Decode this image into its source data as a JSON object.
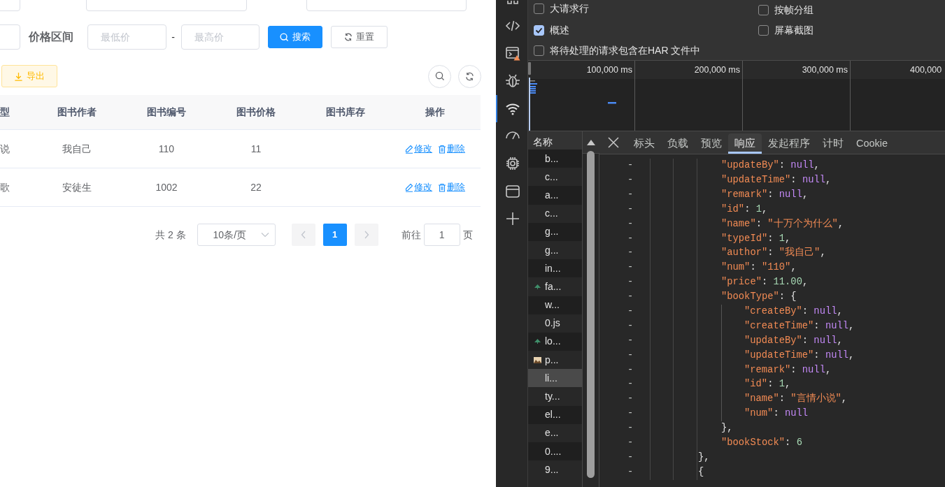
{
  "search_form": {
    "price_range": {
      "label": "价格区间",
      "min_placeholder": "最低价",
      "separator": "-",
      "max_placeholder": "最高价"
    },
    "search_button": "搜索",
    "reset_button": "重置"
  },
  "toolbar": {
    "export_button": "导出"
  },
  "table": {
    "columns": [
      "型",
      "图书作者",
      "图书编号",
      "图书价格",
      "图书库存",
      "操作"
    ],
    "rows": [
      {
        "type": "说",
        "author": "我自己",
        "num": "110",
        "price": "11",
        "actions": [
          "修改",
          "删除"
        ]
      },
      {
        "type": "歌",
        "author": "安徒生",
        "num": "1002",
        "price": "22",
        "actions": [
          "修改",
          "删除"
        ]
      }
    ]
  },
  "pagination": {
    "total": "共 2 条",
    "page_size": "10条/页",
    "prev_disabled": true,
    "next_disabled": true,
    "pages": [
      {
        "label": "1",
        "selected": true
      }
    ],
    "goto_label": "前往",
    "goto_value": "1",
    "page_suffix": "页"
  },
  "activity_bar": {
    "items": [
      {
        "kind": "panels",
        "selected": false
      },
      {
        "kind": "code",
        "selected": false
      },
      {
        "kind": "console",
        "selected": false,
        "warning": true
      },
      {
        "kind": "bug",
        "selected": false
      },
      {
        "kind": "wifi",
        "selected": true
      },
      {
        "kind": "gauge",
        "selected": false
      },
      {
        "kind": "chip",
        "selected": false
      },
      {
        "kind": "window",
        "selected": false
      },
      {
        "kind": "plus",
        "selected": false
      }
    ]
  },
  "settings": {
    "options": [
      {
        "label": "大请求行",
        "checked": false
      },
      {
        "label": "按帧分组",
        "checked": false
      },
      {
        "label": "概述",
        "checked": true
      },
      {
        "label": "屏幕截图",
        "checked": false
      },
      {
        "label": "将待处理的请求包含在HAR 文件中",
        "checked": false
      }
    ]
  },
  "timeline": {
    "ticks": [
      "100,000 ms",
      "200,000 ms",
      "300,000 ms",
      "400,000"
    ]
  },
  "request_list": {
    "header": "名称",
    "items": [
      {
        "name": "b...",
        "kind": "plain",
        "selected": false
      },
      {
        "name": "c...",
        "kind": "plain",
        "selected": false
      },
      {
        "name": "a...",
        "kind": "plain",
        "selected": false
      },
      {
        "name": "c...",
        "kind": "plain",
        "selected": false
      },
      {
        "name": "g...",
        "kind": "plain",
        "selected": false
      },
      {
        "name": "g...",
        "kind": "plain",
        "selected": false
      },
      {
        "name": "in...",
        "kind": "plain",
        "selected": false
      },
      {
        "name": "fa...",
        "kind": "leaf",
        "selected": false
      },
      {
        "name": "w...",
        "kind": "plain",
        "selected": false
      },
      {
        "name": "0.js",
        "kind": "plain",
        "selected": false
      },
      {
        "name": "lo...",
        "kind": "leaf",
        "selected": false
      },
      {
        "name": "p...",
        "kind": "image",
        "selected": false
      },
      {
        "name": "li...",
        "kind": "plain",
        "selected": true
      },
      {
        "name": "ty...",
        "kind": "plain",
        "selected": false
      },
      {
        "name": "el...",
        "kind": "plain",
        "selected": false
      },
      {
        "name": "e...",
        "kind": "plain",
        "selected": false
      },
      {
        "name": "0....",
        "kind": "plain",
        "selected": false
      },
      {
        "name": "9...",
        "kind": "plain",
        "selected": false
      }
    ]
  },
  "detail_tabs": [
    {
      "label": "标头",
      "selected": false
    },
    {
      "label": "负载",
      "selected": false
    },
    {
      "label": "预览",
      "selected": false
    },
    {
      "label": "响应",
      "selected": true
    },
    {
      "label": "发起程序",
      "selected": false
    },
    {
      "label": "计时",
      "selected": false
    },
    {
      "label": "Cookie",
      "selected": false
    }
  ],
  "response": {
    "lines": [
      {
        "children": [
          {
            "marker": "-",
            "key": "\"updateBy\"",
            "sep": ": ",
            "value": "null",
            "kind": "null",
            "tail": ","
          },
          {
            "marker": "-",
            "key": "\"updateTime\"",
            "sep": ": ",
            "value": "null",
            "kind": "null",
            "tail": ","
          },
          {
            "marker": "-",
            "key": "\"remark\"",
            "sep": ": ",
            "value": "null",
            "kind": "null",
            "tail": ","
          },
          {
            "marker": "-",
            "key": "\"id\"",
            "sep": ": ",
            "value": "1",
            "kind": "number",
            "tail": ","
          },
          {
            "marker": "-",
            "key": "\"name\"",
            "sep": ": ",
            "value": "\"十万个为什么\"",
            "kind": "string",
            "tail": ","
          },
          {
            "marker": "-",
            "key": "\"typeId\"",
            "sep": ": ",
            "value": "1",
            "kind": "number",
            "tail": ","
          },
          {
            "marker": "-",
            "key": "\"author\"",
            "sep": ": ",
            "value": "\"我自己\"",
            "kind": "string",
            "tail": ","
          },
          {
            "marker": "-",
            "key": "\"num\"",
            "sep": ": ",
            "value": "\"110\"",
            "kind": "string",
            "tail": ","
          },
          {
            "marker": "-",
            "key": "\"price\"",
            "sep": ": ",
            "value": "11.00",
            "kind": "number",
            "tail": ","
          },
          {
            "marker": "-",
            "key": "\"bookType\"",
            "sep": ": ",
            "value": "{",
            "kind": "punct",
            "children": [
              {
                "marker": "-",
                "key": "\"createBy\"",
                "sep": ": ",
                "value": "null",
                "kind": "null",
                "tail": ","
              },
              {
                "marker": "-",
                "key": "\"createTime\"",
                "sep": ": ",
                "value": "null",
                "kind": "null",
                "tail": ","
              },
              {
                "marker": "-",
                "key": "\"updateBy\"",
                "sep": ": ",
                "value": "null",
                "kind": "null",
                "tail": ","
              },
              {
                "marker": "-",
                "key": "\"updateTime\"",
                "sep": ": ",
                "value": "null",
                "kind": "null",
                "tail": ","
              },
              {
                "marker": "-",
                "key": "\"remark\"",
                "sep": ": ",
                "value": "null",
                "kind": "null",
                "tail": ","
              },
              {
                "marker": "-",
                "key": "\"id\"",
                "sep": ": ",
                "value": "1",
                "kind": "number",
                "tail": ","
              },
              {
                "marker": "-",
                "key": "\"name\"",
                "sep": ": ",
                "value": "\"言情小说\"",
                "kind": "string",
                "tail": ","
              },
              {
                "marker": "-",
                "key": "\"num\"",
                "sep": ": ",
                "value": "null",
                "kind": "null"
              }
            ]
          },
          {
            "marker": "-",
            "value": "}",
            "kind": "punct",
            "tail": ","
          },
          {
            "marker": "-",
            "key": "\"bookStock\"",
            "sep": ": ",
            "value": "6",
            "kind": "number"
          }
        ]
      },
      {
        "marker": "-",
        "value": "}",
        "kind": "punct",
        "tail": ","
      },
      {
        "marker": "-",
        "value": "{",
        "kind": "punct"
      }
    ]
  }
}
